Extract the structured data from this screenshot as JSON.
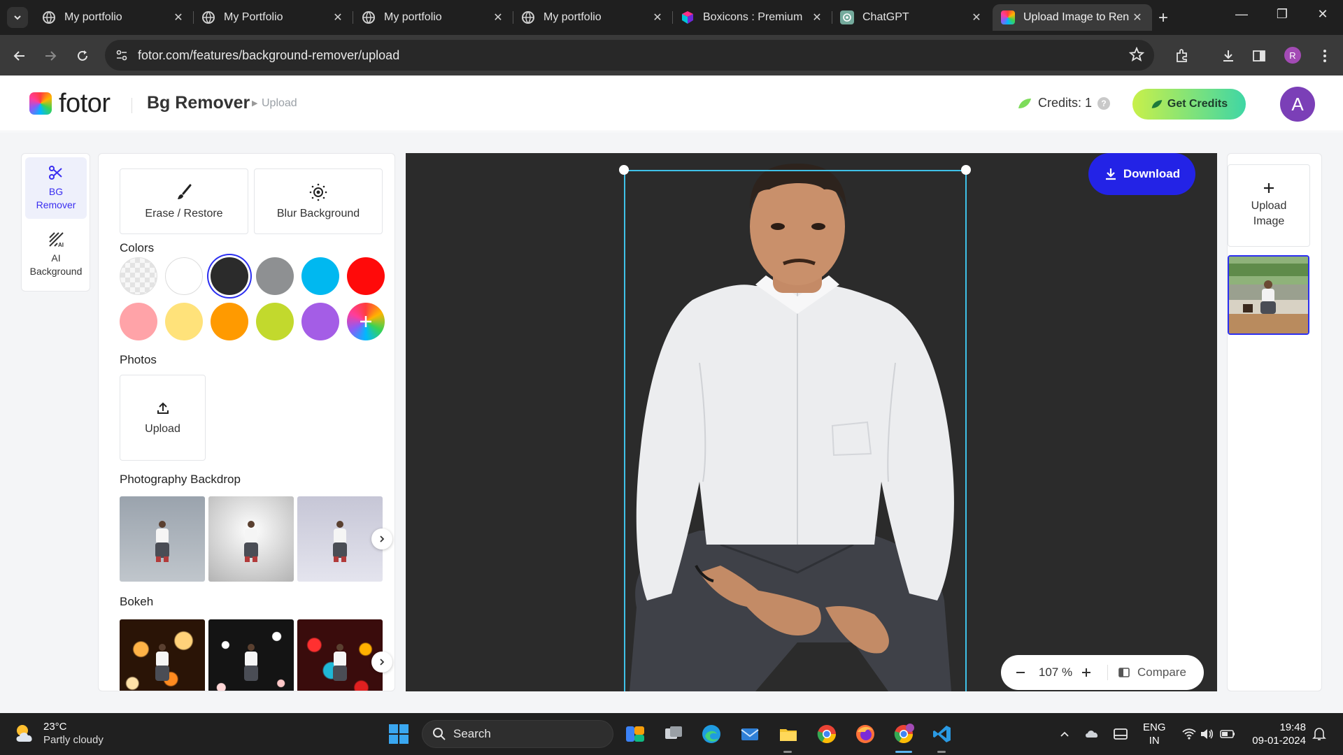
{
  "browser": {
    "tabs": [
      {
        "title": "My portfolio",
        "favicon": "globe-icon",
        "active": false
      },
      {
        "title": "My Portfolio",
        "favicon": "globe-icon",
        "active": false
      },
      {
        "title": "My portfolio",
        "favicon": "globe-icon",
        "active": false
      },
      {
        "title": "My portfolio",
        "favicon": "globe-icon",
        "active": false
      },
      {
        "title": "Boxicons : Premium",
        "favicon": "boxicons-icon",
        "active": false
      },
      {
        "title": "ChatGPT",
        "favicon": "chatgpt-icon",
        "active": false
      },
      {
        "title": "Upload Image to Ren",
        "favicon": "fotor-icon",
        "active": true
      }
    ],
    "url": "fotor.com/features/background-remover/upload",
    "profile_initial": "R"
  },
  "app": {
    "logo_text": "fotor",
    "title": "Bg Remover",
    "crumb": "Upload",
    "credits_label": "Credits: 1",
    "credits_help": "?",
    "get_credits_label": "Get Credits",
    "avatar_initial": "A",
    "accent_color": "#2323e6"
  },
  "rail": {
    "items": [
      {
        "label_line1": "BG",
        "label_line2": "Remover",
        "icon": "scissors-icon",
        "active": true
      },
      {
        "label_line1": "AI",
        "label_line2": "Background",
        "icon": "ai-background-icon",
        "active": false
      }
    ]
  },
  "panel": {
    "tools": [
      {
        "label": "Erase / Restore",
        "icon": "brush-icon"
      },
      {
        "label": "Blur Background",
        "icon": "blur-icon"
      }
    ],
    "colors_title": "Colors",
    "colors": [
      "transparent",
      "#ffffff",
      "#2b2b2b",
      "#8e9092",
      "#00b8f0",
      "#ff0a0a",
      "#ffa3a8",
      "#ffe27a",
      "#ff9a00",
      "#c2d92d",
      "#a45de6",
      "custom"
    ],
    "selected_color": "#2b2b2b",
    "photos_title": "Photos",
    "upload_label": "Upload",
    "backdrop_title": "Photography Backdrop",
    "bokeh_title": "Bokeh"
  },
  "canvas": {
    "download_label": "Download",
    "zoom_level": "107 %",
    "compare_label": "Compare",
    "background_color": "#2b2b2b"
  },
  "right": {
    "upload_line1": "Upload",
    "upload_line2": "Image"
  },
  "taskbar": {
    "weather_temp": "23°C",
    "weather_desc": "Partly cloudy",
    "search_label": "Search",
    "lang_line1": "ENG",
    "lang_line2": "IN",
    "time": "19:48",
    "date": "09-01-2024"
  }
}
